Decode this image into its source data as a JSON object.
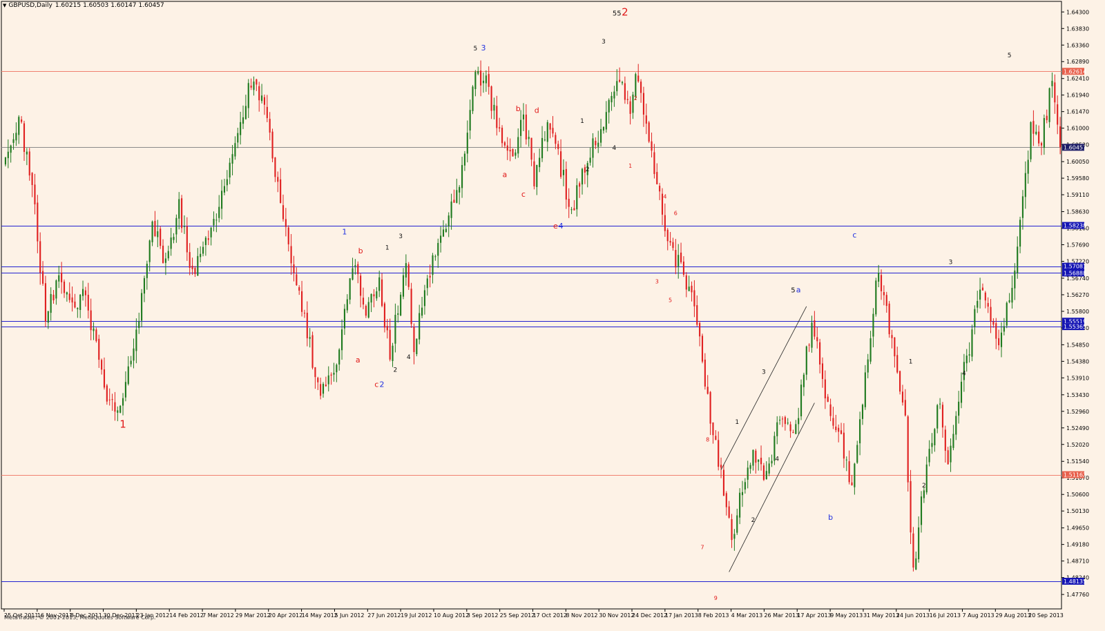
{
  "window": {
    "symbol": "GBPUSD,Daily",
    "ohlc": [
      "1.60215",
      "1.60503",
      "1.60147",
      "1.60457"
    ],
    "copyright": "MetaTrader, © 2001-2013, MetaQuotes Software Corp."
  },
  "colors": {
    "background": "#fdf2e6",
    "bull": "#1f7a1f",
    "bear": "#e02020",
    "hline_blue": "#2020d0",
    "hline_red": "#f08070",
    "hline_gray": "#8a8a8a",
    "axis": "#000000"
  },
  "chart_data": {
    "type": "candlestick",
    "y_range": [
      1.4735,
      1.646
    ],
    "y_ticks": [
      "1.64300",
      "1.63830",
      "1.63360",
      "1.62890",
      "1.62410",
      "1.61940",
      "1.61470",
      "1.61000",
      "1.60530",
      "1.60050",
      "1.59580",
      "1.59110",
      "1.58630",
      "1.58160",
      "1.57690",
      "1.57220",
      "1.56740",
      "1.56270",
      "1.55800",
      "1.55330",
      "1.54850",
      "1.54380",
      "1.53910",
      "1.53430",
      "1.52960",
      "1.52490",
      "1.52020",
      "1.51540",
      "1.51070",
      "1.50600",
      "1.50130",
      "1.49650",
      "1.49180",
      "1.48710",
      "1.48240",
      "1.47760"
    ],
    "x_labels": [
      "25 Oct 2011",
      "16 Nov 2011",
      "8 Dec 2011",
      "30 Dec 2011",
      "23 Jan 2012",
      "14 Feb 2012",
      "7 Mar 2012",
      "29 Mar 2012",
      "20 Apr 2012",
      "14 May 2012",
      "5 Jun 2012",
      "27 Jun 2012",
      "19 Jul 2012",
      "10 Aug 2012",
      "3 Sep 2012",
      "25 Sep 2012",
      "17 Oct 2012",
      "8 Nov 2012",
      "30 Nov 2012",
      "24 Dec 2012",
      "17 Jan 2013",
      "8 Feb 2013",
      "4 Mar 2013",
      "26 Mar 2013",
      "17 Apr 2013",
      "9 May 2013",
      "31 May 2013",
      "24 Jun 2013",
      "16 Jul 2013",
      "7 Aug 2013",
      "29 Aug 2013",
      "20 Sep 2013"
    ],
    "hlines": [
      {
        "price": 1.62614,
        "label": "1.62614",
        "color": "red"
      },
      {
        "price": 1.60457,
        "label": "1.60457",
        "color": "gray"
      },
      {
        "price": 1.58238,
        "label": "1.58238",
        "color": "blue"
      },
      {
        "price": 1.57081,
        "label": "1.57081",
        "color": "blue"
      },
      {
        "price": 1.56888,
        "label": "1.56888",
        "color": "blue"
      },
      {
        "price": 1.55519,
        "label": "1.55519",
        "color": "blue"
      },
      {
        "price": 1.55365,
        "label": "1.55365",
        "color": "blue"
      },
      {
        "price": 1.51162,
        "label": "1.51162",
        "color": "red"
      },
      {
        "price": 1.48135,
        "label": "1.48135",
        "color": "blue"
      }
    ],
    "anchors": [
      {
        "bar": 0,
        "price": 1.602
      },
      {
        "bar": 5,
        "price": 1.613
      },
      {
        "bar": 10,
        "price": 1.595
      },
      {
        "bar": 15,
        "price": 1.556
      },
      {
        "bar": 20,
        "price": 1.568
      },
      {
        "bar": 25,
        "price": 1.558
      },
      {
        "bar": 30,
        "price": 1.563
      },
      {
        "bar": 38,
        "price": 1.532
      },
      {
        "bar": 43,
        "price": 1.529
      },
      {
        "bar": 48,
        "price": 1.547
      },
      {
        "bar": 55,
        "price": 1.582
      },
      {
        "bar": 60,
        "price": 1.572
      },
      {
        "bar": 65,
        "price": 1.588
      },
      {
        "bar": 70,
        "price": 1.568
      },
      {
        "bar": 78,
        "price": 1.582
      },
      {
        "bar": 85,
        "price": 1.602
      },
      {
        "bar": 92,
        "price": 1.624
      },
      {
        "bar": 97,
        "price": 1.616
      },
      {
        "bar": 104,
        "price": 1.585
      },
      {
        "bar": 112,
        "price": 1.556
      },
      {
        "bar": 118,
        "price": 1.533
      },
      {
        "bar": 124,
        "price": 1.545
      },
      {
        "bar": 130,
        "price": 1.572
      },
      {
        "bar": 135,
        "price": 1.558
      },
      {
        "bar": 140,
        "price": 1.566
      },
      {
        "bar": 144,
        "price": 1.545
      },
      {
        "bar": 150,
        "price": 1.573
      },
      {
        "bar": 153,
        "price": 1.548
      },
      {
        "bar": 158,
        "price": 1.568
      },
      {
        "bar": 165,
        "price": 1.582
      },
      {
        "bar": 170,
        "price": 1.596
      },
      {
        "bar": 176,
        "price": 1.624
      },
      {
        "bar": 180,
        "price": 1.624
      },
      {
        "bar": 186,
        "price": 1.604
      },
      {
        "bar": 190,
        "price": 1.601
      },
      {
        "bar": 194,
        "price": 1.614
      },
      {
        "bar": 198,
        "price": 1.596
      },
      {
        "bar": 203,
        "price": 1.612
      },
      {
        "bar": 207,
        "price": 1.602
      },
      {
        "bar": 212,
        "price": 1.586
      },
      {
        "bar": 218,
        "price": 1.602
      },
      {
        "bar": 224,
        "price": 1.611
      },
      {
        "bar": 230,
        "price": 1.625
      },
      {
        "bar": 234,
        "price": 1.614
      },
      {
        "bar": 236,
        "price": 1.625
      },
      {
        "bar": 240,
        "price": 1.61
      },
      {
        "bar": 244,
        "price": 1.594
      },
      {
        "bar": 248,
        "price": 1.576
      },
      {
        "bar": 252,
        "price": 1.572
      },
      {
        "bar": 256,
        "price": 1.565
      },
      {
        "bar": 260,
        "price": 1.55
      },
      {
        "bar": 264,
        "price": 1.528
      },
      {
        "bar": 268,
        "price": 1.512
      },
      {
        "bar": 272,
        "price": 1.492
      },
      {
        "bar": 276,
        "price": 1.508
      },
      {
        "bar": 280,
        "price": 1.516
      },
      {
        "bar": 285,
        "price": 1.511
      },
      {
        "bar": 290,
        "price": 1.528
      },
      {
        "bar": 296,
        "price": 1.524
      },
      {
        "bar": 302,
        "price": 1.556
      },
      {
        "bar": 308,
        "price": 1.53
      },
      {
        "bar": 313,
        "price": 1.521
      },
      {
        "bar": 317,
        "price": 1.508
      },
      {
        "bar": 322,
        "price": 1.54
      },
      {
        "bar": 327,
        "price": 1.57
      },
      {
        "bar": 332,
        "price": 1.548
      },
      {
        "bar": 337,
        "price": 1.526
      },
      {
        "bar": 340,
        "price": 1.483
      },
      {
        "bar": 343,
        "price": 1.505
      },
      {
        "bar": 347,
        "price": 1.523
      },
      {
        "bar": 350,
        "price": 1.532
      },
      {
        "bar": 353,
        "price": 1.512
      },
      {
        "bar": 357,
        "price": 1.535
      },
      {
        "bar": 361,
        "price": 1.548
      },
      {
        "bar": 365,
        "price": 1.565
      },
      {
        "bar": 369,
        "price": 1.556
      },
      {
        "bar": 372,
        "price": 1.551
      },
      {
        "bar": 376,
        "price": 1.562
      },
      {
        "bar": 380,
        "price": 1.582
      },
      {
        "bar": 384,
        "price": 1.61
      },
      {
        "bar": 388,
        "price": 1.606
      },
      {
        "bar": 392,
        "price": 1.623
      },
      {
        "bar": 395,
        "price": 1.6046
      }
    ],
    "wave_labels": [
      {
        "text": "1",
        "bar": 44,
        "price": 1.525,
        "color": "red",
        "size": 15
      },
      {
        "text": "1",
        "bar": 127,
        "price": 1.5798,
        "color": "blue",
        "size": 11
      },
      {
        "text": "b",
        "bar": 133,
        "price": 1.5745,
        "color": "red",
        "size": 11
      },
      {
        "text": "a",
        "bar": 132,
        "price": 1.5435,
        "color": "red",
        "size": 11
      },
      {
        "text": "c",
        "bar": 139,
        "price": 1.5365,
        "color": "red",
        "size": 11
      },
      {
        "text": "2",
        "bar": 141,
        "price": 1.5365,
        "color": "blue",
        "size": 11
      },
      {
        "text": "3",
        "bar": 148,
        "price": 1.5788,
        "color": "black",
        "size": 9
      },
      {
        "text": "1",
        "bar": 143,
        "price": 1.5755,
        "color": "black",
        "size": 9
      },
      {
        "text": "2",
        "bar": 146,
        "price": 1.5408,
        "color": "black",
        "size": 9
      },
      {
        "text": "4",
        "bar": 151,
        "price": 1.5445,
        "color": "black",
        "size": 9
      },
      {
        "text": "5",
        "bar": 176,
        "price": 1.6321,
        "color": "black",
        "size": 9
      },
      {
        "text": "3",
        "bar": 179,
        "price": 1.6321,
        "color": "blue",
        "size": 11
      },
      {
        "text": "a",
        "bar": 187,
        "price": 1.5961,
        "color": "red",
        "size": 11
      },
      {
        "text": "b",
        "bar": 192,
        "price": 1.6148,
        "color": "red",
        "size": 11
      },
      {
        "text": "c",
        "bar": 194,
        "price": 1.5905,
        "color": "red",
        "size": 11
      },
      {
        "text": "d",
        "bar": 199,
        "price": 1.6143,
        "color": "red",
        "size": 11
      },
      {
        "text": "e",
        "bar": 206,
        "price": 1.5815,
        "color": "red",
        "size": 11
      },
      {
        "text": "4",
        "bar": 208,
        "price": 1.5815,
        "color": "blue",
        "size": 11
      },
      {
        "text": "1",
        "bar": 216,
        "price": 1.6115,
        "color": "black",
        "size": 9
      },
      {
        "text": "2",
        "bar": 218,
        "price": 1.5978,
        "color": "black",
        "size": 9
      },
      {
        "text": "3",
        "bar": 224,
        "price": 1.634,
        "color": "black",
        "size": 9
      },
      {
        "text": "55",
        "bar": 229,
        "price": 1.642,
        "color": "black",
        "size": 10
      },
      {
        "text": "2",
        "bar": 232,
        "price": 1.642,
        "color": "red",
        "size": 15
      },
      {
        "text": "4",
        "bar": 228,
        "price": 1.6039,
        "color": "black",
        "size": 9
      },
      {
        "text": "2",
        "bar": 236,
        "price": 1.618,
        "color": "red",
        "size": 8
      },
      {
        "text": "1",
        "bar": 234,
        "price": 1.5988,
        "color": "red",
        "size": 8
      },
      {
        "text": "4",
        "bar": 247,
        "price": 1.59,
        "color": "red",
        "size": 8
      },
      {
        "text": "6",
        "bar": 251,
        "price": 1.5853,
        "color": "red",
        "size": 8
      },
      {
        "text": "3",
        "bar": 244,
        "price": 1.5659,
        "color": "red",
        "size": 8
      },
      {
        "text": "5",
        "bar": 249,
        "price": 1.5606,
        "color": "red",
        "size": 8
      },
      {
        "text": "8",
        "bar": 263,
        "price": 1.521,
        "color": "red",
        "size": 8
      },
      {
        "text": "7",
        "bar": 261,
        "price": 1.4905,
        "color": "red",
        "size": 8
      },
      {
        "text": "9",
        "bar": 266,
        "price": 1.476,
        "color": "red",
        "size": 8
      },
      {
        "text": "1",
        "bar": 274,
        "price": 1.526,
        "color": "black",
        "size": 9
      },
      {
        "text": "2",
        "bar": 280,
        "price": 1.4982,
        "color": "black",
        "size": 9
      },
      {
        "text": "3",
        "bar": 284,
        "price": 1.5402,
        "color": "black",
        "size": 9
      },
      {
        "text": "4",
        "bar": 289,
        "price": 1.5155,
        "color": "black",
        "size": 9
      },
      {
        "text": "5",
        "bar": 295,
        "price": 1.5634,
        "color": "black",
        "size": 10
      },
      {
        "text": "a",
        "bar": 297,
        "price": 1.5634,
        "color": "blue",
        "size": 11
      },
      {
        "text": "b",
        "bar": 309,
        "price": 1.4988,
        "color": "blue",
        "size": 11
      },
      {
        "text": "c",
        "bar": 318,
        "price": 1.579,
        "color": "blue",
        "size": 11
      },
      {
        "text": "1",
        "bar": 339,
        "price": 1.5432,
        "color": "black",
        "size": 9
      },
      {
        "text": "2",
        "bar": 344,
        "price": 1.508,
        "color": "black",
        "size": 9
      },
      {
        "text": "3",
        "bar": 354,
        "price": 1.5714,
        "color": "black",
        "size": 9
      },
      {
        "text": "4",
        "bar": 359,
        "price": 1.5399,
        "color": "black",
        "size": 9
      },
      {
        "text": "5",
        "bar": 376,
        "price": 1.6301,
        "color": "black",
        "size": 9
      }
    ],
    "trend_lines": [
      {
        "from": {
          "bar": 268,
          "price": 1.513
        },
        "to": {
          "bar": 300,
          "price": 1.5594
        }
      },
      {
        "from": {
          "bar": 271,
          "price": 1.484
        },
        "to": {
          "bar": 303,
          "price": 1.532
        }
      }
    ]
  }
}
